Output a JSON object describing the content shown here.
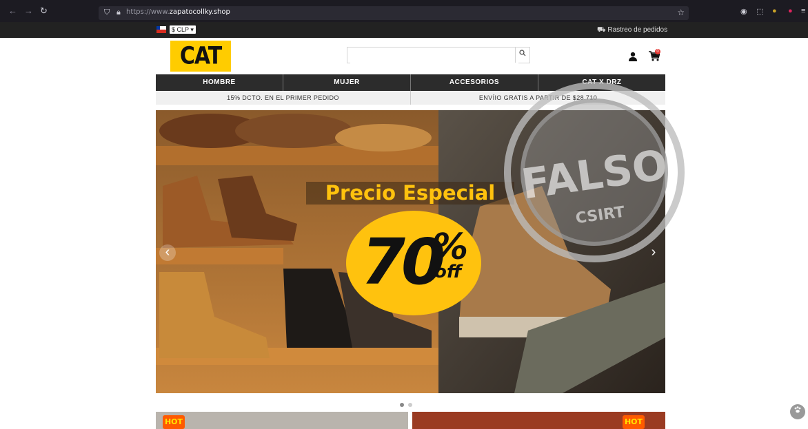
{
  "browser": {
    "url_prefix": "https://www.",
    "url_domain": "zapatocollky.shop"
  },
  "topbar": {
    "currency": "$ CLP ▾",
    "tracking": "⛟ Rastreo de pedidos"
  },
  "header": {
    "logo": "CAT",
    "search_placeholder": "",
    "search_icon": "search-icon",
    "cart_count": "0"
  },
  "menu": [
    "HOMBRE",
    "MUJER",
    "ACCESORIOS",
    "CAT X DRZ"
  ],
  "promos": [
    "15% DCTO. EN EL PRIMER PEDIDO",
    "ENVÍIO GRATIS A PARTIR DE $28.710"
  ],
  "hero": {
    "headline": "Precio Especial",
    "discount_number": "70",
    "discount_percent": "%",
    "discount_off": "off"
  },
  "stamp": {
    "word": "FALSO",
    "org": "CSIRT"
  },
  "banners": {
    "hot_label": "HOT"
  },
  "carousel": {
    "slides": 2,
    "active": 1
  }
}
